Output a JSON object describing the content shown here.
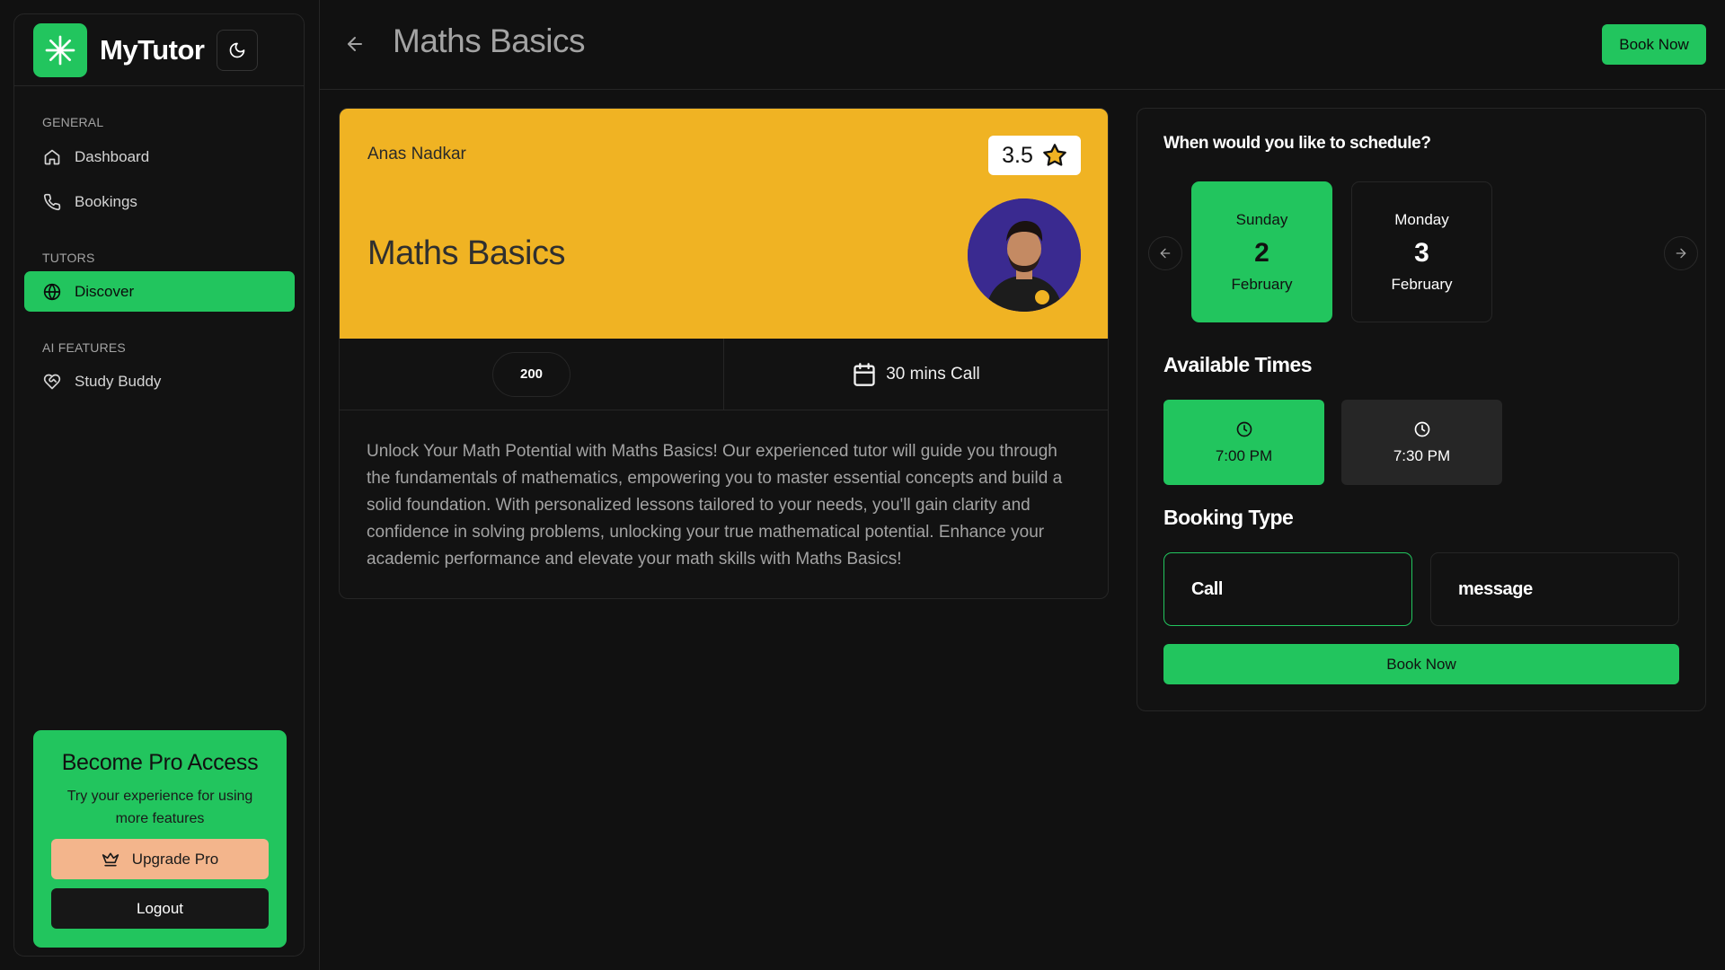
{
  "brand": {
    "name": "MyTutor",
    "logo_icon": "asterisk-icon",
    "accent": "#22c55e"
  },
  "sidebar": {
    "sections": [
      {
        "label": "GENERAL",
        "items": [
          {
            "label": "Dashboard",
            "icon": "home-icon"
          },
          {
            "label": "Bookings",
            "icon": "phone-icon"
          }
        ]
      },
      {
        "label": "TUTORS",
        "items": [
          {
            "label": "Discover",
            "icon": "globe-icon",
            "active": true
          }
        ]
      },
      {
        "label": "AI FEATURES",
        "items": [
          {
            "label": "Study Buddy",
            "icon": "heart-handshake-icon"
          }
        ]
      }
    ],
    "pro": {
      "title": "Become Pro Access",
      "description": "Try your experience for using more features",
      "upgrade_label": "Upgrade Pro",
      "logout_label": "Logout"
    }
  },
  "header": {
    "title": "Maths Basics",
    "book_label": "Book Now"
  },
  "course": {
    "tutor_name": "Anas Nadkar",
    "rating": "3.5",
    "title": "Maths Basics",
    "banner_color": "#f0b323",
    "price": "200",
    "call_duration": "30 mins Call",
    "description": "Unlock Your Math Potential with Maths Basics! Our experienced tutor will guide you through the fundamentals of mathematics, empowering you to master essential concepts and build a solid foundation. With personalized lessons tailored to your needs, you'll gain clarity and confidence in solving problems, unlocking your true mathematical potential. Enhance your academic performance and elevate your math skills with Maths Basics!"
  },
  "schedule": {
    "question": "When would you like to schedule?",
    "days": [
      {
        "weekday": "Sunday",
        "day": "2",
        "month": "February",
        "selected": true
      },
      {
        "weekday": "Monday",
        "day": "3",
        "month": "February",
        "selected": false
      }
    ],
    "times_title": "Available Times",
    "times": [
      {
        "label": "7:00 PM",
        "selected": true
      },
      {
        "label": "7:30 PM",
        "selected": false
      }
    ],
    "type_title": "Booking Type",
    "types": [
      {
        "label": "Call",
        "selected": true
      },
      {
        "label": "message",
        "selected": false
      }
    ],
    "book_label": "Book Now"
  }
}
